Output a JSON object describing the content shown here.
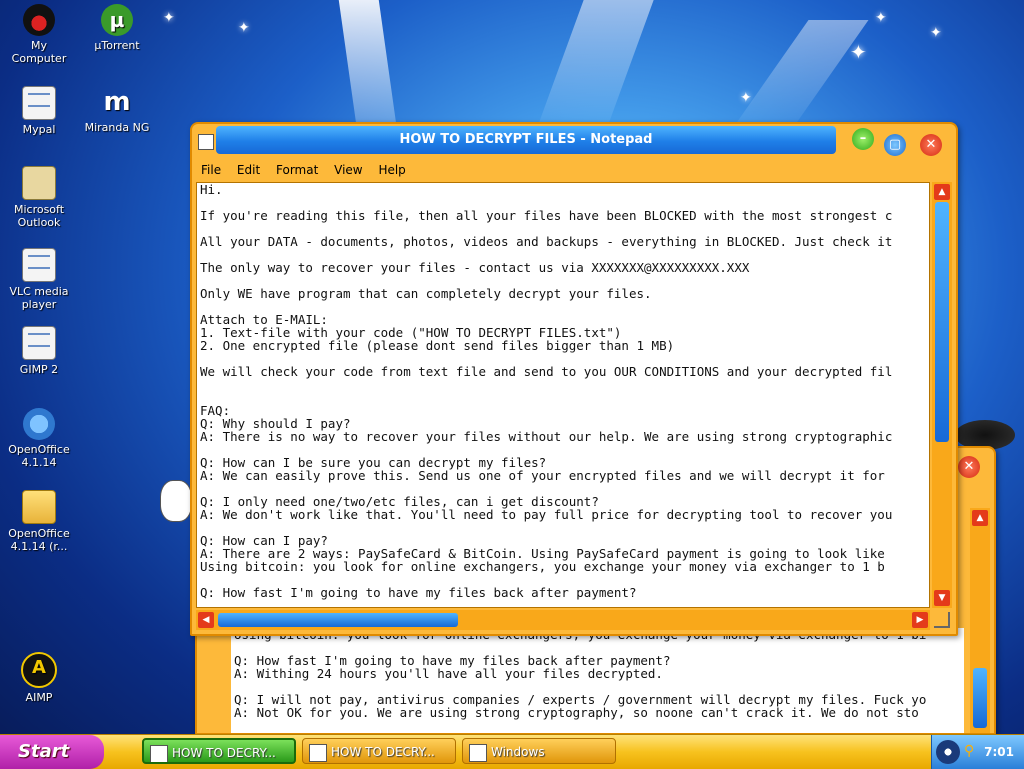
{
  "desktop_icons": [
    {
      "label_lines": [
        "My",
        "Computer"
      ],
      "icon": "mickey-computer-icon"
    },
    {
      "label_lines": [
        "µTorrent"
      ],
      "icon": "utorrent-icon"
    },
    {
      "label_lines": [
        "Mypal"
      ],
      "icon": "mypal-icon"
    },
    {
      "label_lines": [
        "Miranda NG"
      ],
      "icon": "miranda-icon"
    },
    {
      "label_lines": [
        "Microsoft",
        "Outlook"
      ],
      "icon": "outlook-icon"
    },
    {
      "label_lines": [
        "VLC media",
        "player"
      ],
      "icon": "vlc-icon"
    },
    {
      "label_lines": [
        "GIMP 2"
      ],
      "icon": "gimp-icon"
    },
    {
      "label_lines": [
        "OpenOffice",
        "4.1.14"
      ],
      "icon": "openoffice-icon"
    },
    {
      "label_lines": [
        "OpenOffice",
        "4.1.14 (r..."
      ],
      "icon": "openoffice-folder-icon"
    },
    {
      "label_lines": [
        "AIMP"
      ],
      "icon": "aimp-icon"
    }
  ],
  "notepad": {
    "title": "HOW TO DECRYPT FILES - Notepad",
    "menu": [
      "File",
      "Edit",
      "Format",
      "View",
      "Help"
    ],
    "lines": [
      "Hi.",
      "",
      "If you're reading this file, then all your files have been BLOCKED with the most strongest c",
      "",
      "All your DATA - documents, photos, videos and backups - everything in BLOCKED. Just check it",
      "",
      "The only way to recover your files - contact us via XXXXXXX@XXXXXXXXX.XXX",
      "",
      "Only WE have program that can completely decrypt your files.",
      "",
      "Attach to E-MAIL:",
      "1. Text-file with your code (\"HOW TO DECRYPT FILES.txt\")",
      "2. One encrypted file (please dont send files bigger than 1 MB)",
      "",
      "We will check your code from text file and send to you OUR CONDITIONS and your decrypted fil",
      "",
      "",
      "FAQ:",
      "Q: Why should I pay?",
      "A: There is no way to recover your files without our help. We are using strong cryptographic",
      "",
      "Q: How can I be sure you can decrypt my files?",
      "A: We can easily prove this. Send us one of your encrypted files and we will decrypt it for",
      "",
      "Q: I only need one/two/etc files, can i get discount?",
      "A: We don't work like that. You'll need to pay full price for decrypting tool to recover you",
      "",
      "Q: How can I pay?",
      "A: There are 2 ways: PaySafeCard & BitCoin. Using PaySafeCard payment is going to look like",
      "Using bitcoin: you look for online exchangers, you exchange your money via exchanger to 1 b",
      "",
      "Q: How fast I'm going to have my files back after payment?"
    ]
  },
  "back_window": {
    "lines": [
      "Using bitcoin: you look for online exchangers, you exchange your money via exchanger to 1 bi",
      "",
      "Q: How fast I'm going to have my files back after payment?",
      "A: Withing 24 hours you'll have all your files decrypted.",
      "",
      "Q: I will not pay, antivirus companies / experts / government will decrypt my files. Fuck yo",
      "A: Not OK for you. We are using strong cryptography, so noone can't crack it. We do not sto"
    ]
  },
  "taskbar": {
    "start_label": "Start",
    "tasks": [
      "HOW TO DECRY...",
      "HOW TO DECRY...",
      "Windows"
    ],
    "clock": "7:01"
  }
}
